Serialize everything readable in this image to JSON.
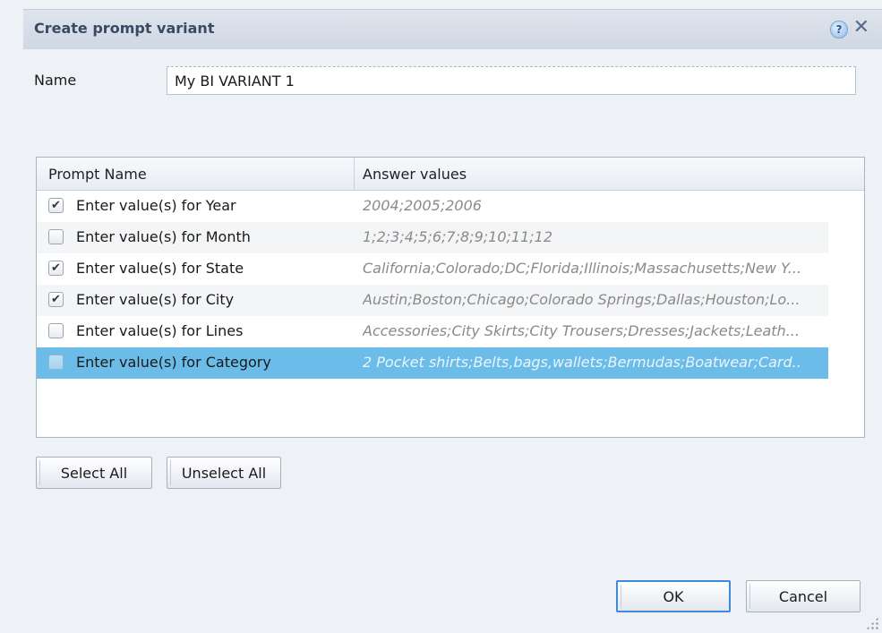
{
  "dialog": {
    "title": "Create prompt variant",
    "help_icon": "help-icon",
    "close_icon": "close-icon"
  },
  "name_field": {
    "label": "Name",
    "value": "My BI VARIANT 1"
  },
  "grid": {
    "columns": [
      "Prompt Name",
      "Answer values"
    ],
    "rows": [
      {
        "checked": true,
        "prompt": "Enter value(s) for Year",
        "answer": "2004;2005;2006",
        "selected": false
      },
      {
        "checked": false,
        "prompt": "Enter value(s) for Month",
        "answer": "1;2;3;4;5;6;7;8;9;10;11;12",
        "selected": false
      },
      {
        "checked": true,
        "prompt": "Enter value(s) for State",
        "answer": "California;Colorado;DC;Florida;Illinois;Massachusetts;New Y...",
        "selected": false
      },
      {
        "checked": true,
        "prompt": "Enter value(s) for City",
        "answer": "Austin;Boston;Chicago;Colorado Springs;Dallas;Houston;Lo...",
        "selected": false
      },
      {
        "checked": false,
        "prompt": "Enter value(s) for Lines",
        "answer": "Accessories;City Skirts;City Trousers;Dresses;Jackets;Leath...",
        "selected": false
      },
      {
        "checked": false,
        "prompt": "Enter value(s) for Category",
        "answer": "2 Pocket shirts;Belts,bags,wallets;Bermudas;Boatwear;Card..",
        "selected": true
      }
    ]
  },
  "buttons": {
    "select_all": "Select All",
    "unselect_all": "Unselect All",
    "ok": "OK",
    "cancel": "Cancel"
  },
  "colors": {
    "selected_row": "#6bbce8",
    "ok_focus_border": "#3f8ad8",
    "title_text": "#3a4a63"
  }
}
